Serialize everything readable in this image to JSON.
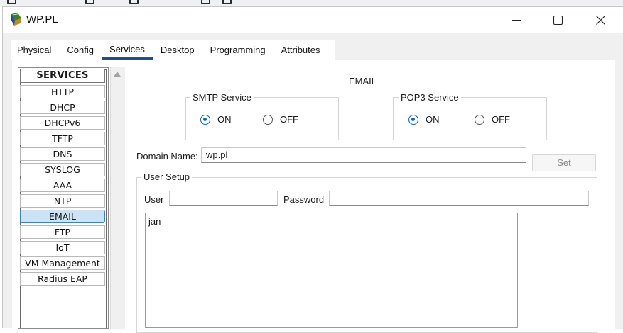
{
  "window": {
    "title": "WP.PL"
  },
  "tabs": [
    {
      "label": "Physical"
    },
    {
      "label": "Config"
    },
    {
      "label": "Services",
      "active": true
    },
    {
      "label": "Desktop"
    },
    {
      "label": "Programming"
    },
    {
      "label": "Attributes"
    }
  ],
  "services": {
    "header": "SERVICES",
    "items": [
      "HTTP",
      "DHCP",
      "DHCPv6",
      "TFTP",
      "DNS",
      "SYSLOG",
      "AAA",
      "NTP",
      "EMAIL",
      "FTP",
      "IoT",
      "VM Management",
      "Radius EAP"
    ],
    "selected": "EMAIL"
  },
  "email": {
    "title": "EMAIL",
    "smtp": {
      "legend": "SMTP Service",
      "on_label": "ON",
      "off_label": "OFF",
      "selected": "ON"
    },
    "pop3": {
      "legend": "POP3 Service",
      "on_label": "ON",
      "off_label": "OFF",
      "selected": "ON"
    },
    "domain": {
      "label": "Domain Name:",
      "value": "wp.pl",
      "set_label": "Set"
    },
    "user_setup": {
      "legend": "User Setup",
      "user_label": "User",
      "user_value": "",
      "password_label": "Password",
      "password_value": "",
      "users": [
        "jan"
      ]
    }
  },
  "colors": {
    "accent": "#1061c4",
    "tab_underline": "#1e4f86",
    "selected_item": "#cde2f7"
  }
}
